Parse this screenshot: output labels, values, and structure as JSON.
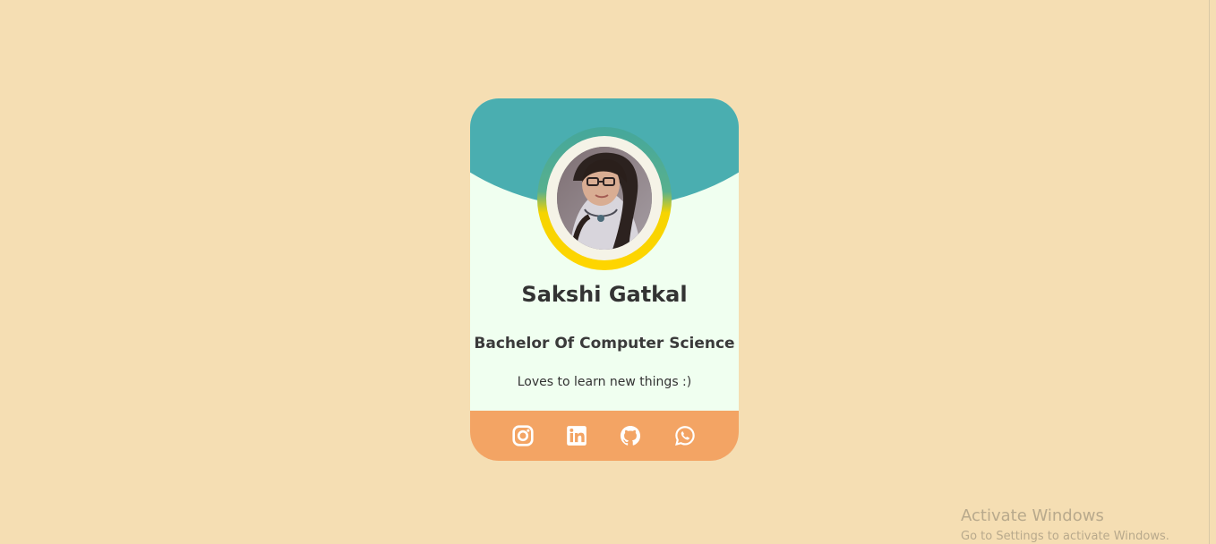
{
  "profile": {
    "name": "Sakshi Gatkal",
    "degree": "Bachelor Of Computer Science",
    "tagline": "Loves to learn new things :)"
  },
  "social_links": [
    {
      "label": "Instagram",
      "icon": "instagram-icon"
    },
    {
      "label": "LinkedIn",
      "icon": "linkedin-icon"
    },
    {
      "label": "GitHub",
      "icon": "github-icon"
    },
    {
      "label": "WhatsApp",
      "icon": "whatsapp-icon"
    }
  ],
  "watermark": {
    "title": "Activate Windows",
    "subtitle": "Go to Settings to activate Windows."
  },
  "colors": {
    "page_background": "#f5deb3",
    "card_background": "#f0fff0",
    "header_teal": "#4aaeb0",
    "avatar_ring_yellow": "#ffd500",
    "footer_orange": "#f3a464",
    "text_dark": "#333333"
  }
}
